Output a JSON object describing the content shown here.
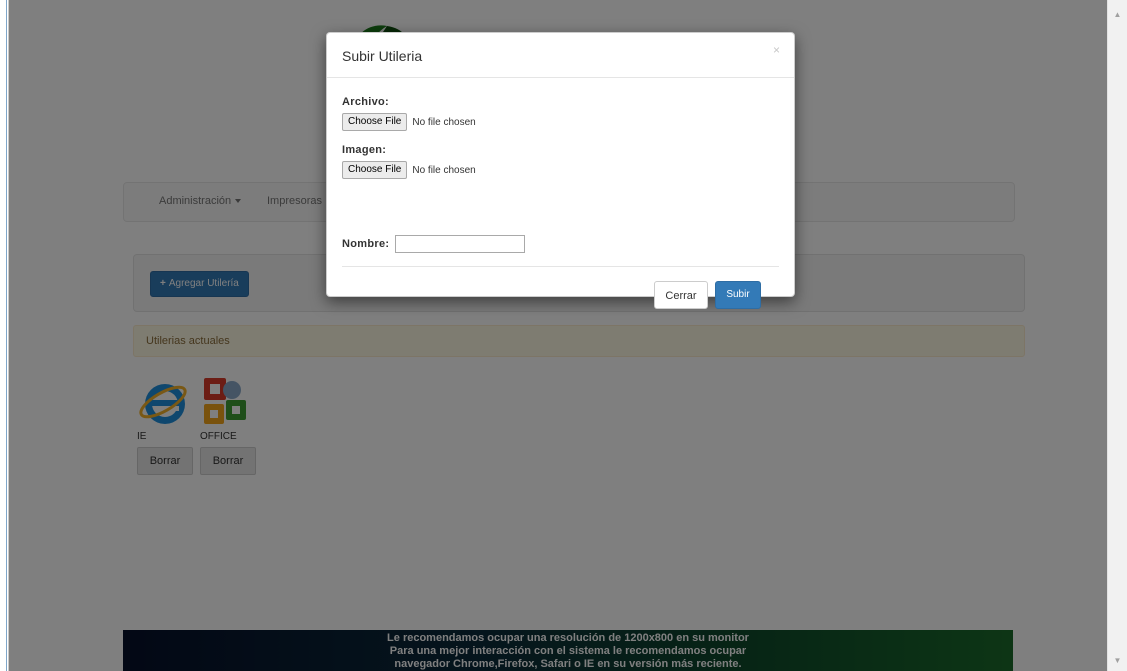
{
  "nav": {
    "admin_label": "Administración",
    "printers_label": "Impresoras"
  },
  "toolbar": {
    "add_label": "Agregar Utilería"
  },
  "current": {
    "title": "Utilerias actuales"
  },
  "tools": [
    {
      "name": "IE",
      "delete_label": "Borrar",
      "icon": "internet-explorer-icon"
    },
    {
      "name": "OFFICE",
      "delete_label": "Borrar",
      "icon": "office-icon"
    }
  ],
  "footer": {
    "lines": [
      "Le recomendamos ocupar una resolución de 1200x800 en su monitor",
      "Para una mejor interacción con el sistema le recomendamos ocupar",
      "navegador Chrome,Firefox, Safari o IE en su versión más reciente."
    ]
  },
  "modal": {
    "title": "Subir Utileria",
    "close_glyph": "×",
    "archivo_label": "Archivo:",
    "imagen_label": "Imagen:",
    "nombre_label": "Nombre:",
    "nombre_value": "",
    "file_button_label": "Choose File",
    "file_status": "No file chosen",
    "cerrar_label": "Cerrar",
    "subir_label": "Subir"
  },
  "colors": {
    "primary": "#337ab7",
    "alert_bg": "#fcf8e3",
    "overlay": "rgba(0,0,0,0.5)"
  }
}
